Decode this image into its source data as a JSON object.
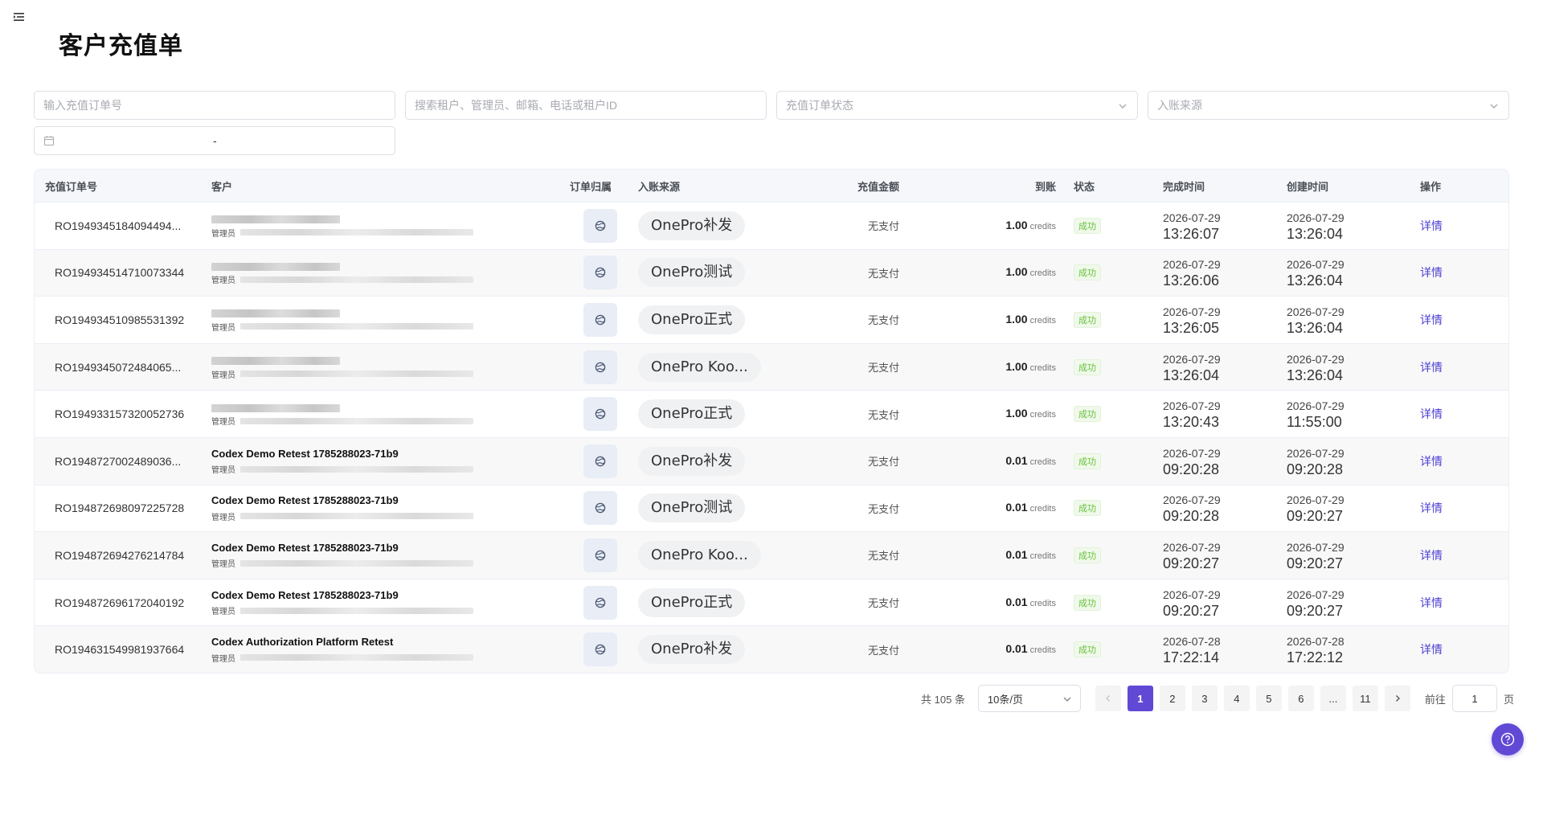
{
  "page": {
    "title": "客户充值单"
  },
  "filters": {
    "order_no_placeholder": "输入充值订单号",
    "search_placeholder": "搜索租户、管理员、邮箱、电话或租户ID",
    "status_placeholder": "充值订单状态",
    "source_placeholder": "入账来源",
    "date_separator": "-"
  },
  "table": {
    "headers": {
      "order_no": "充值订单号",
      "customer": "客户",
      "owner": "订单归属",
      "source": "入账来源",
      "amount": "充值金额",
      "arrival": "到账",
      "status": "状态",
      "completed": "完成时间",
      "created": "创建时间",
      "action": "操作"
    },
    "rows": [
      {
        "order_no": "RO1949345184094494...",
        "customer_name": "",
        "role": "管理员",
        "source": "OnePro补发",
        "amount": "无支付",
        "arrival": "1.00",
        "unit": "credits",
        "status": "成功",
        "done_date": "2026-07-29",
        "done_time": "13:26:07",
        "created_date": "2026-07-29",
        "created_time": "13:26:04",
        "action": "详情"
      },
      {
        "order_no": "RO194934514710073344",
        "customer_name": "",
        "role": "管理员",
        "source": "OnePro测试",
        "amount": "无支付",
        "arrival": "1.00",
        "unit": "credits",
        "status": "成功",
        "done_date": "2026-07-29",
        "done_time": "13:26:06",
        "created_date": "2026-07-29",
        "created_time": "13:26:04",
        "action": "详情"
      },
      {
        "order_no": "RO194934510985531392",
        "customer_name": "",
        "role": "管理员",
        "source": "OnePro正式",
        "amount": "无支付",
        "arrival": "1.00",
        "unit": "credits",
        "status": "成功",
        "done_date": "2026-07-29",
        "done_time": "13:26:05",
        "created_date": "2026-07-29",
        "created_time": "13:26:04",
        "action": "详情"
      },
      {
        "order_no": "RO1949345072484065...",
        "customer_name": "",
        "role": "管理员",
        "source": "OnePro Koo...",
        "amount": "无支付",
        "arrival": "1.00",
        "unit": "credits",
        "status": "成功",
        "done_date": "2026-07-29",
        "done_time": "13:26:04",
        "created_date": "2026-07-29",
        "created_time": "13:26:04",
        "action": "详情"
      },
      {
        "order_no": "RO194933157320052736",
        "customer_name": "",
        "role": "管理员",
        "source": "OnePro正式",
        "amount": "无支付",
        "arrival": "1.00",
        "unit": "credits",
        "status": "成功",
        "done_date": "2026-07-29",
        "done_time": "13:20:43",
        "created_date": "2026-07-29",
        "created_time": "11:55:00",
        "action": "详情"
      },
      {
        "order_no": "RO1948727002489036...",
        "customer_name": "Codex Demo Retest 1785288023-71b9",
        "role": "管理员",
        "source": "OnePro补发",
        "amount": "无支付",
        "arrival": "0.01",
        "unit": "credits",
        "status": "成功",
        "done_date": "2026-07-29",
        "done_time": "09:20:28",
        "created_date": "2026-07-29",
        "created_time": "09:20:28",
        "action": "详情"
      },
      {
        "order_no": "RO194872698097225728",
        "customer_name": "Codex Demo Retest 1785288023-71b9",
        "role": "管理员",
        "source": "OnePro测试",
        "amount": "无支付",
        "arrival": "0.01",
        "unit": "credits",
        "status": "成功",
        "done_date": "2026-07-29",
        "done_time": "09:20:28",
        "created_date": "2026-07-29",
        "created_time": "09:20:27",
        "action": "详情"
      },
      {
        "order_no": "RO194872694276214784",
        "customer_name": "Codex Demo Retest 1785288023-71b9",
        "role": "管理员",
        "source": "OnePro Koo...",
        "amount": "无支付",
        "arrival": "0.01",
        "unit": "credits",
        "status": "成功",
        "done_date": "2026-07-29",
        "done_time": "09:20:27",
        "created_date": "2026-07-29",
        "created_time": "09:20:27",
        "action": "详情"
      },
      {
        "order_no": "RO194872696172040192",
        "customer_name": "Codex Demo Retest 1785288023-71b9",
        "role": "管理员",
        "source": "OnePro正式",
        "amount": "无支付",
        "arrival": "0.01",
        "unit": "credits",
        "status": "成功",
        "done_date": "2026-07-29",
        "done_time": "09:20:27",
        "created_date": "2026-07-29",
        "created_time": "09:20:27",
        "action": "详情"
      },
      {
        "order_no": "RO194631549981937664",
        "customer_name": "Codex Authorization Platform Retest",
        "role": "管理员",
        "source": "OnePro补发",
        "amount": "无支付",
        "arrival": "0.01",
        "unit": "credits",
        "status": "成功",
        "done_date": "2026-07-28",
        "done_time": "17:22:14",
        "created_date": "2026-07-28",
        "created_time": "17:22:12",
        "action": "详情"
      }
    ]
  },
  "pagination": {
    "total_label": "共 105 条",
    "page_size": "10条/页",
    "pages": [
      "1",
      "2",
      "3",
      "4",
      "5",
      "6",
      "...",
      "11"
    ],
    "current": "1",
    "goto_label": "前往",
    "goto_value": "1",
    "page_suffix": "页"
  },
  "icons": {
    "menu": "menu-fold-icon",
    "calendar": "calendar-icon",
    "chevron": "chevron-down-icon",
    "owner": "globe-icon",
    "help": "question-circle-icon"
  },
  "colors": {
    "accent": "#6149d6",
    "link": "#4b3fd1",
    "success": "#67c23a",
    "success_bg": "#f0f9eb"
  }
}
